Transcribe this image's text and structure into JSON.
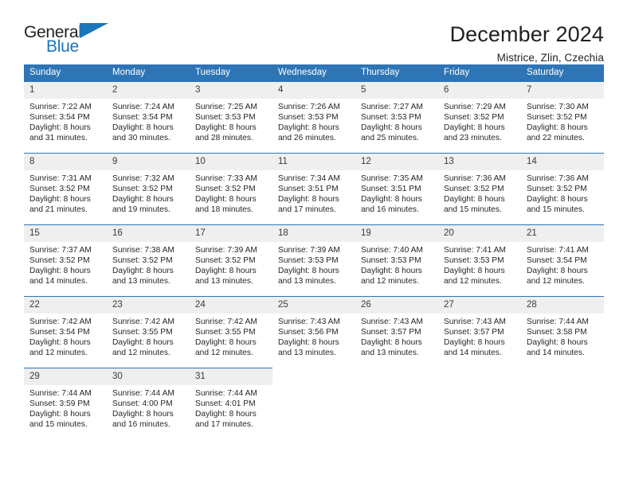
{
  "brand": {
    "name_part1": "General",
    "name_part2": "Blue",
    "logo_icon": "triangle-logo-icon",
    "accent_color": "#1b75bb"
  },
  "header": {
    "title": "December 2024",
    "location": "Mistrice, Zlin, Czechia",
    "header_bg_color": "#2e75b6",
    "daynum_bg_color": "#efefef"
  },
  "weekday_headers": [
    "Sunday",
    "Monday",
    "Tuesday",
    "Wednesday",
    "Thursday",
    "Friday",
    "Saturday"
  ],
  "labels": {
    "sunrise_prefix": "Sunrise:",
    "sunset_prefix": "Sunset:",
    "daylight_prefix": "Daylight:"
  },
  "weeks": [
    [
      {
        "day": "1",
        "sunrise": "Sunrise: 7:22 AM",
        "sunset": "Sunset: 3:54 PM",
        "daylight_line1": "Daylight: 8 hours",
        "daylight_line2": "and 31 minutes."
      },
      {
        "day": "2",
        "sunrise": "Sunrise: 7:24 AM",
        "sunset": "Sunset: 3:54 PM",
        "daylight_line1": "Daylight: 8 hours",
        "daylight_line2": "and 30 minutes."
      },
      {
        "day": "3",
        "sunrise": "Sunrise: 7:25 AM",
        "sunset": "Sunset: 3:53 PM",
        "daylight_line1": "Daylight: 8 hours",
        "daylight_line2": "and 28 minutes."
      },
      {
        "day": "4",
        "sunrise": "Sunrise: 7:26 AM",
        "sunset": "Sunset: 3:53 PM",
        "daylight_line1": "Daylight: 8 hours",
        "daylight_line2": "and 26 minutes."
      },
      {
        "day": "5",
        "sunrise": "Sunrise: 7:27 AM",
        "sunset": "Sunset: 3:53 PM",
        "daylight_line1": "Daylight: 8 hours",
        "daylight_line2": "and 25 minutes."
      },
      {
        "day": "6",
        "sunrise": "Sunrise: 7:29 AM",
        "sunset": "Sunset: 3:52 PM",
        "daylight_line1": "Daylight: 8 hours",
        "daylight_line2": "and 23 minutes."
      },
      {
        "day": "7",
        "sunrise": "Sunrise: 7:30 AM",
        "sunset": "Sunset: 3:52 PM",
        "daylight_line1": "Daylight: 8 hours",
        "daylight_line2": "and 22 minutes."
      }
    ],
    [
      {
        "day": "8",
        "sunrise": "Sunrise: 7:31 AM",
        "sunset": "Sunset: 3:52 PM",
        "daylight_line1": "Daylight: 8 hours",
        "daylight_line2": "and 21 minutes."
      },
      {
        "day": "9",
        "sunrise": "Sunrise: 7:32 AM",
        "sunset": "Sunset: 3:52 PM",
        "daylight_line1": "Daylight: 8 hours",
        "daylight_line2": "and 19 minutes."
      },
      {
        "day": "10",
        "sunrise": "Sunrise: 7:33 AM",
        "sunset": "Sunset: 3:52 PM",
        "daylight_line1": "Daylight: 8 hours",
        "daylight_line2": "and 18 minutes."
      },
      {
        "day": "11",
        "sunrise": "Sunrise: 7:34 AM",
        "sunset": "Sunset: 3:51 PM",
        "daylight_line1": "Daylight: 8 hours",
        "daylight_line2": "and 17 minutes."
      },
      {
        "day": "12",
        "sunrise": "Sunrise: 7:35 AM",
        "sunset": "Sunset: 3:51 PM",
        "daylight_line1": "Daylight: 8 hours",
        "daylight_line2": "and 16 minutes."
      },
      {
        "day": "13",
        "sunrise": "Sunrise: 7:36 AM",
        "sunset": "Sunset: 3:52 PM",
        "daylight_line1": "Daylight: 8 hours",
        "daylight_line2": "and 15 minutes."
      },
      {
        "day": "14",
        "sunrise": "Sunrise: 7:36 AM",
        "sunset": "Sunset: 3:52 PM",
        "daylight_line1": "Daylight: 8 hours",
        "daylight_line2": "and 15 minutes."
      }
    ],
    [
      {
        "day": "15",
        "sunrise": "Sunrise: 7:37 AM",
        "sunset": "Sunset: 3:52 PM",
        "daylight_line1": "Daylight: 8 hours",
        "daylight_line2": "and 14 minutes."
      },
      {
        "day": "16",
        "sunrise": "Sunrise: 7:38 AM",
        "sunset": "Sunset: 3:52 PM",
        "daylight_line1": "Daylight: 8 hours",
        "daylight_line2": "and 13 minutes."
      },
      {
        "day": "17",
        "sunrise": "Sunrise: 7:39 AM",
        "sunset": "Sunset: 3:52 PM",
        "daylight_line1": "Daylight: 8 hours",
        "daylight_line2": "and 13 minutes."
      },
      {
        "day": "18",
        "sunrise": "Sunrise: 7:39 AM",
        "sunset": "Sunset: 3:53 PM",
        "daylight_line1": "Daylight: 8 hours",
        "daylight_line2": "and 13 minutes."
      },
      {
        "day": "19",
        "sunrise": "Sunrise: 7:40 AM",
        "sunset": "Sunset: 3:53 PM",
        "daylight_line1": "Daylight: 8 hours",
        "daylight_line2": "and 12 minutes."
      },
      {
        "day": "20",
        "sunrise": "Sunrise: 7:41 AM",
        "sunset": "Sunset: 3:53 PM",
        "daylight_line1": "Daylight: 8 hours",
        "daylight_line2": "and 12 minutes."
      },
      {
        "day": "21",
        "sunrise": "Sunrise: 7:41 AM",
        "sunset": "Sunset: 3:54 PM",
        "daylight_line1": "Daylight: 8 hours",
        "daylight_line2": "and 12 minutes."
      }
    ],
    [
      {
        "day": "22",
        "sunrise": "Sunrise: 7:42 AM",
        "sunset": "Sunset: 3:54 PM",
        "daylight_line1": "Daylight: 8 hours",
        "daylight_line2": "and 12 minutes."
      },
      {
        "day": "23",
        "sunrise": "Sunrise: 7:42 AM",
        "sunset": "Sunset: 3:55 PM",
        "daylight_line1": "Daylight: 8 hours",
        "daylight_line2": "and 12 minutes."
      },
      {
        "day": "24",
        "sunrise": "Sunrise: 7:42 AM",
        "sunset": "Sunset: 3:55 PM",
        "daylight_line1": "Daylight: 8 hours",
        "daylight_line2": "and 12 minutes."
      },
      {
        "day": "25",
        "sunrise": "Sunrise: 7:43 AM",
        "sunset": "Sunset: 3:56 PM",
        "daylight_line1": "Daylight: 8 hours",
        "daylight_line2": "and 13 minutes."
      },
      {
        "day": "26",
        "sunrise": "Sunrise: 7:43 AM",
        "sunset": "Sunset: 3:57 PM",
        "daylight_line1": "Daylight: 8 hours",
        "daylight_line2": "and 13 minutes."
      },
      {
        "day": "27",
        "sunrise": "Sunrise: 7:43 AM",
        "sunset": "Sunset: 3:57 PM",
        "daylight_line1": "Daylight: 8 hours",
        "daylight_line2": "and 14 minutes."
      },
      {
        "day": "28",
        "sunrise": "Sunrise: 7:44 AM",
        "sunset": "Sunset: 3:58 PM",
        "daylight_line1": "Daylight: 8 hours",
        "daylight_line2": "and 14 minutes."
      }
    ],
    [
      {
        "day": "29",
        "sunrise": "Sunrise: 7:44 AM",
        "sunset": "Sunset: 3:59 PM",
        "daylight_line1": "Daylight: 8 hours",
        "daylight_line2": "and 15 minutes."
      },
      {
        "day": "30",
        "sunrise": "Sunrise: 7:44 AM",
        "sunset": "Sunset: 4:00 PM",
        "daylight_line1": "Daylight: 8 hours",
        "daylight_line2": "and 16 minutes."
      },
      {
        "day": "31",
        "sunrise": "Sunrise: 7:44 AM",
        "sunset": "Sunset: 4:01 PM",
        "daylight_line1": "Daylight: 8 hours",
        "daylight_line2": "and 17 minutes."
      },
      {
        "day": "",
        "sunrise": "",
        "sunset": "",
        "daylight_line1": "",
        "daylight_line2": ""
      },
      {
        "day": "",
        "sunrise": "",
        "sunset": "",
        "daylight_line1": "",
        "daylight_line2": ""
      },
      {
        "day": "",
        "sunrise": "",
        "sunset": "",
        "daylight_line1": "",
        "daylight_line2": ""
      },
      {
        "day": "",
        "sunrise": "",
        "sunset": "",
        "daylight_line1": "",
        "daylight_line2": ""
      }
    ]
  ]
}
